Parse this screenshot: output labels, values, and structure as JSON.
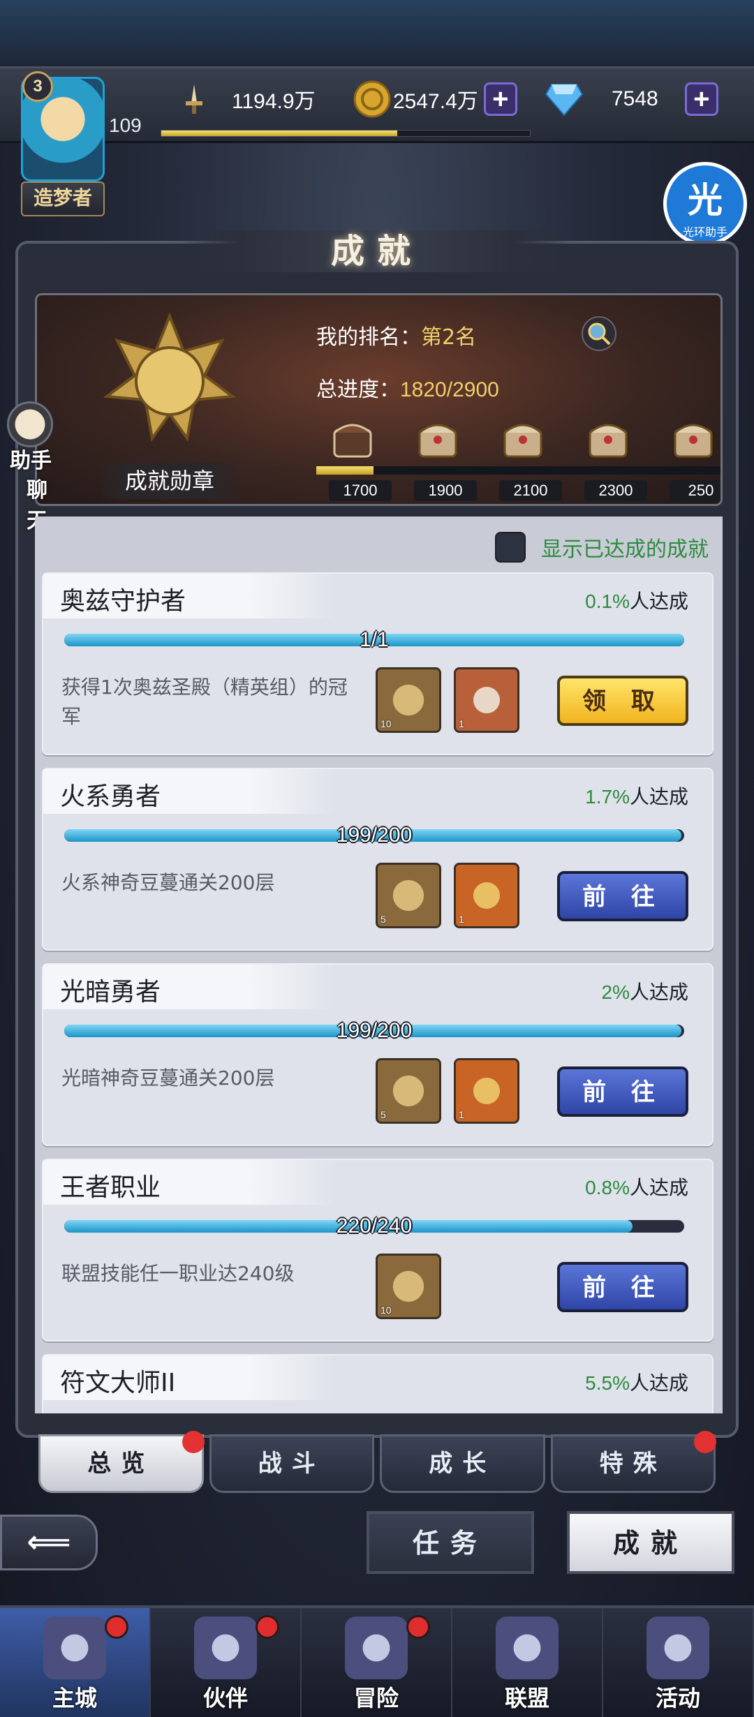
{
  "player": {
    "level_badge": "3",
    "rank_title": "造梦者",
    "level": "109",
    "xp_progress": 0.64
  },
  "resources": {
    "power": "1194.9万",
    "gold": "2547.4万",
    "diamonds": "7548"
  },
  "assistant": {
    "icon_char": "光",
    "label": "光环助手"
  },
  "page_title": "成就",
  "medal": {
    "label": "成就勋章"
  },
  "ranking": {
    "label": "我的排名：",
    "value": "第2名"
  },
  "total_progress": {
    "label": "总进度：",
    "value": "1820/2900"
  },
  "milestones": [
    "1700",
    "1900",
    "2100",
    "2300",
    "250"
  ],
  "milestone_fill": 0.14,
  "side_helper": {
    "line1": "助手",
    "line2": "聊 天"
  },
  "toggle_label": "显示已达成的成就",
  "achievements": [
    {
      "title": "奥兹守护者",
      "pct": "0.1%",
      "pct_suffix": "人达成",
      "progress_text": "1/1",
      "progress": 1.0,
      "desc": "获得1次奥兹圣殿（精英组）的冠军",
      "rewards": [
        {
          "count": "10"
        },
        {
          "count": "1"
        }
      ],
      "button": "领 取",
      "button_type": "claim"
    },
    {
      "title": "火系勇者",
      "pct": "1.7%",
      "pct_suffix": "人达成",
      "progress_text": "199/200",
      "progress": 0.995,
      "desc": "火系神奇豆蔓通关200层",
      "rewards": [
        {
          "count": "5"
        },
        {
          "count": "1"
        }
      ],
      "button": "前 往",
      "button_type": "go"
    },
    {
      "title": "光暗勇者",
      "pct": "2%",
      "pct_suffix": "人达成",
      "progress_text": "199/200",
      "progress": 0.995,
      "desc": "光暗神奇豆蔓通关200层",
      "rewards": [
        {
          "count": "5"
        },
        {
          "count": "1"
        }
      ],
      "button": "前 往",
      "button_type": "go"
    },
    {
      "title": "王者职业",
      "pct": "0.8%",
      "pct_suffix": "人达成",
      "progress_text": "220/240",
      "progress": 0.917,
      "desc": "联盟技能任一职业达240级",
      "rewards": [
        {
          "count": "10"
        }
      ],
      "button": "前 往",
      "button_type": "go"
    },
    {
      "title": "符文大师II",
      "pct": "5.5%",
      "pct_suffix": "人达成"
    }
  ],
  "tabs": [
    {
      "label": "总览",
      "active": true,
      "dot": true
    },
    {
      "label": "战斗",
      "active": false,
      "dot": false
    },
    {
      "label": "成长",
      "active": false,
      "dot": false
    },
    {
      "label": "特殊",
      "active": false,
      "dot": true
    }
  ],
  "back_icon": "back-arrow-icon",
  "mode_buttons": {
    "task": "任务",
    "achievement": "成就"
  },
  "bottom_nav": [
    {
      "label": "主城",
      "active": true,
      "dot": true
    },
    {
      "label": "伙伴",
      "active": false,
      "dot": true
    },
    {
      "label": "冒险",
      "active": false,
      "dot": true
    },
    {
      "label": "联盟",
      "active": false,
      "dot": false
    },
    {
      "label": "活动",
      "active": false,
      "dot": false
    }
  ]
}
